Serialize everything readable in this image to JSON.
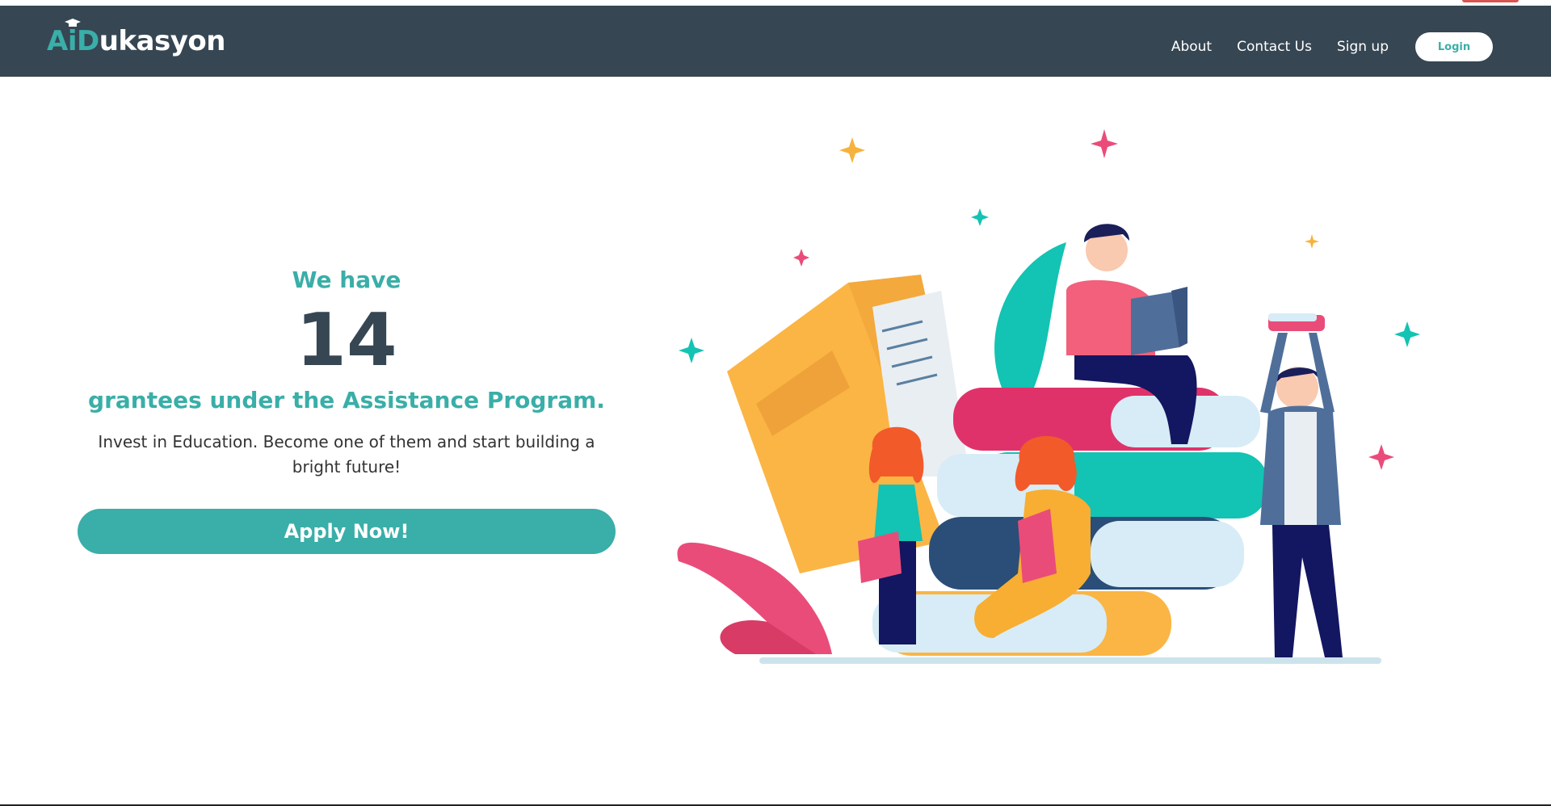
{
  "brand": {
    "name_accent": "AiD",
    "name_rest": "ukasyon"
  },
  "nav": {
    "about": "About",
    "contact": "Contact Us",
    "signup": "Sign up",
    "login": "Login"
  },
  "hero": {
    "lead": "We have",
    "count": "14",
    "subtitle": "grantees under the Assistance Program.",
    "tagline": "Invest in Education. Become one of them and start building a bright future!",
    "cta": "Apply Now!"
  },
  "colors": {
    "navbar": "#364653",
    "accent": "#3aaea8",
    "text_dark": "#364653"
  },
  "icons": {
    "brand_cap": "graduation-cap-icon"
  }
}
